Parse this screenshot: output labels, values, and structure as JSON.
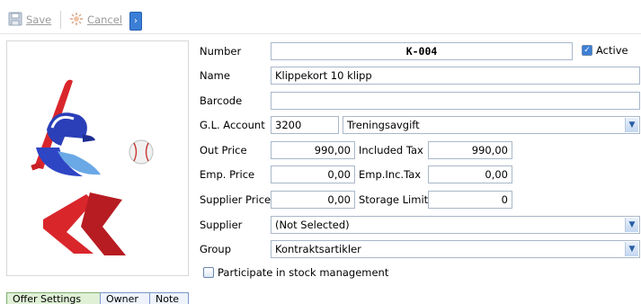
{
  "toolbar": {
    "save_label": "Save",
    "cancel_label": "Cancel",
    "expand_icon": "chevron-right-icon"
  },
  "image": {
    "description_icon": "baseball-player-logo"
  },
  "form": {
    "number_label": "Number",
    "number_value": "K-004",
    "active_label": "Active",
    "active_checked": true,
    "name_label": "Name",
    "name_value": "Klippekort  10 klipp",
    "barcode_label": "Barcode",
    "barcode_value": "",
    "gl_label": "G.L. Account",
    "gl_code": "3200",
    "gl_name": "Treningsavgift",
    "out_price_label": "Out Price",
    "out_price_value": "990,00",
    "included_tax_label": "Included Tax",
    "included_tax_value": "990,00",
    "emp_price_label": "Emp. Price",
    "emp_price_value": "0,00",
    "emp_inc_tax_label": "Emp.Inc.Tax",
    "emp_inc_tax_value": "0,00",
    "supplier_price_label": "Supplier Price",
    "supplier_price_value": "0,00",
    "storage_limit_label": "Storage Limit",
    "storage_limit_value": "0",
    "supplier_label": "Supplier",
    "supplier_value": "(Not Selected)",
    "group_label": "Group",
    "group_value": "Kontraktsartikler",
    "stock_label": "Participate in stock management",
    "stock_checked": false
  },
  "tabs": [
    {
      "label": "Offer Settings",
      "active": true
    },
    {
      "label": "Owner",
      "active": false
    },
    {
      "label": "Note",
      "active": false
    }
  ],
  "colors": {
    "accent": "#3b7ed6",
    "input_border": "#a9b7c9",
    "active_tab": "#dff0d6"
  }
}
